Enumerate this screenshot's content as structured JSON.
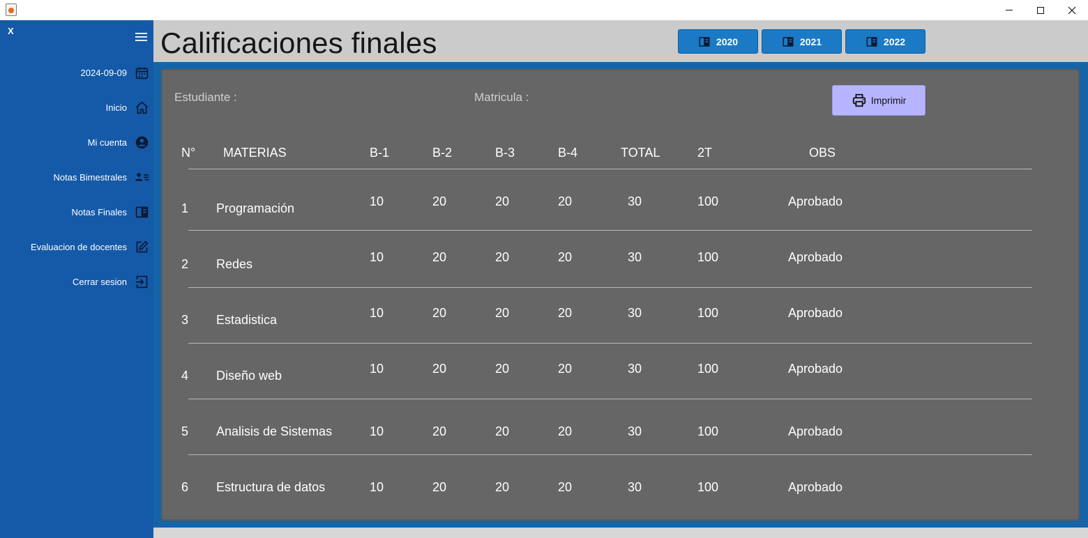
{
  "window": {
    "buttons": {
      "minimize": "minimize",
      "maximize": "maximize",
      "close": "close"
    }
  },
  "sidebar": {
    "close_label": "X",
    "items": [
      {
        "label": "2024-09-09",
        "icon": "calendar-icon"
      },
      {
        "label": "Inicio",
        "icon": "home-icon"
      },
      {
        "label": "Mi cuenta",
        "icon": "account-circle-icon"
      },
      {
        "label": "Notas Bimestrales",
        "icon": "contact-list-icon"
      },
      {
        "label": "Notas Finales",
        "icon": "book-icon"
      },
      {
        "label": "Evaluacion de docentes",
        "icon": "edit-icon"
      },
      {
        "label": "Cerrar sesion",
        "icon": "logout-icon"
      }
    ]
  },
  "header": {
    "title": "Calificaciones finales",
    "years": [
      "2020",
      "2021",
      "2022"
    ]
  },
  "student": {
    "student_label": "Estudiante :",
    "matricula_label": "Matricula :",
    "print_label": "Imprimir"
  },
  "table": {
    "headers": [
      "N°",
      "MATERIAS",
      "B-1",
      "B-2",
      "B-3",
      "B-4",
      "TOTAL",
      "2T",
      "OBS"
    ],
    "rows": [
      {
        "n": "1",
        "materia": "Programación",
        "b1": "10",
        "b2": "20",
        "b3": "20",
        "b4": "20",
        "total": "30",
        "t2": "100",
        "obs": "Aprobado"
      },
      {
        "n": "2",
        "materia": "Redes",
        "b1": "10",
        "b2": "20",
        "b3": "20",
        "b4": "20",
        "total": "30",
        "t2": "100",
        "obs": "Aprobado"
      },
      {
        "n": "3",
        "materia": "Estadistica",
        "b1": "10",
        "b2": "20",
        "b3": "20",
        "b4": "20",
        "total": "30",
        "t2": "100",
        "obs": "Aprobado"
      },
      {
        "n": "4",
        "materia": "Diseño web",
        "b1": "10",
        "b2": "20",
        "b3": "20",
        "b4": "20",
        "total": "30",
        "t2": "100",
        "obs": "Aprobado"
      },
      {
        "n": "5",
        "materia": "Analisis de Sistemas",
        "b1": "10",
        "b2": "20",
        "b3": "20",
        "b4": "20",
        "total": "30",
        "t2": "100",
        "obs": "Aprobado"
      },
      {
        "n": "6",
        "materia": "Estructura de datos",
        "b1": "10",
        "b2": "20",
        "b3": "20",
        "b4": "20",
        "total": "30",
        "t2": "100",
        "obs": "Aprobado"
      }
    ]
  },
  "colors": {
    "sidebar": "#155aa8",
    "header": "#cbcbcb",
    "panel": "#666666",
    "year_button": "#1b7ac6",
    "print_button": "#b7b5ff"
  }
}
